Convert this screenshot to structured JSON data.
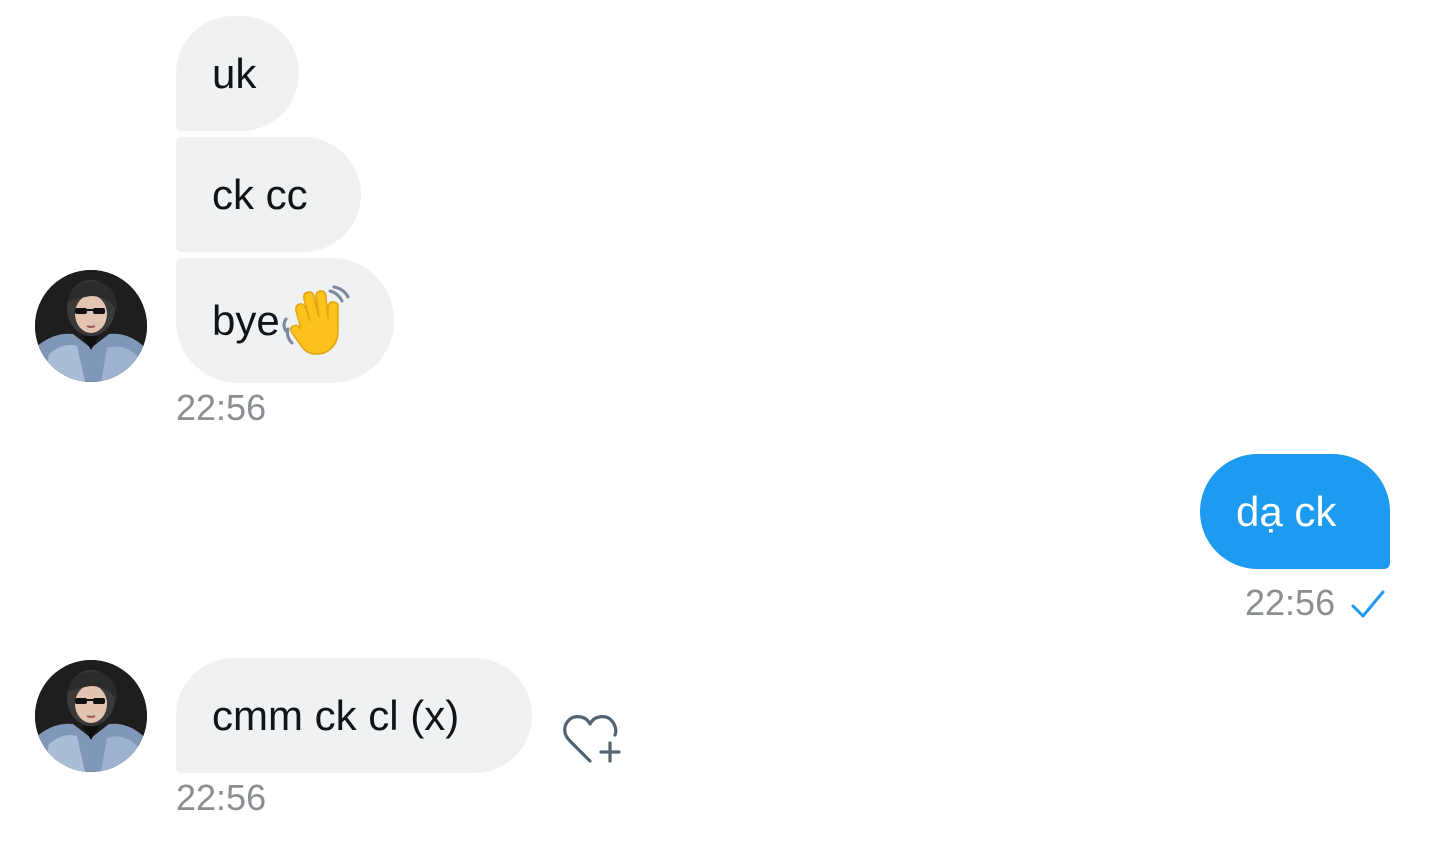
{
  "messages": {
    "m1": "uk",
    "m2": "ck cc",
    "m3": "bye",
    "m3_emoji": "👋",
    "m4": "dạ ck",
    "m5": "cmm ck cl (x)"
  },
  "timestamps": {
    "t1": "22:56",
    "t2": "22:56",
    "t3": "22:56"
  },
  "icons": {
    "avatar": "profile-photo",
    "read_receipt": "check-icon",
    "reaction": "heart-plus-icon",
    "wave": "waving-hand-emoji"
  },
  "colors": {
    "incoming_bubble": "#eff1f3",
    "outgoing_bubble": "#1d9bf0",
    "timestamp": "#8b8f93",
    "check": "#1d9bf0"
  }
}
